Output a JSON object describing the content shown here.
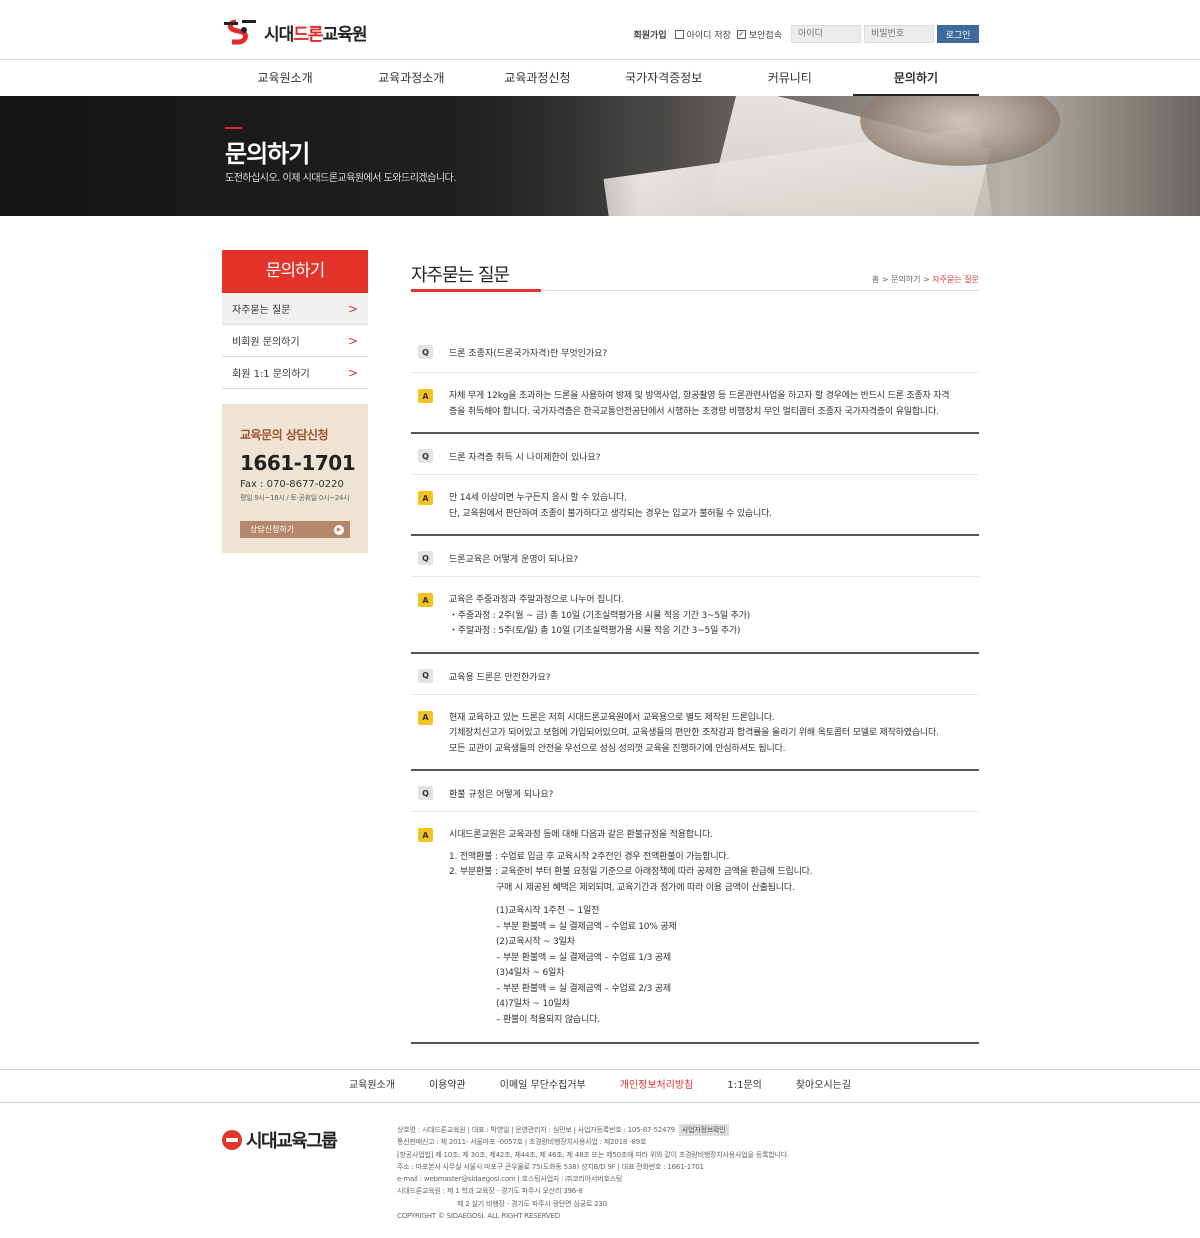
{
  "header": {
    "logo_text_pre": "시대",
    "logo_text_red": "드론",
    "logo_text_post": "교육원",
    "join": "회원가입",
    "save_id": "아이디 저장",
    "secure": "보안접속",
    "id_placeholder": "아이디",
    "pw_placeholder": "비밀번호",
    "login": "로그인"
  },
  "gnb": [
    "교육원소개",
    "교육과정소개",
    "교육과정신청",
    "국가자격증정보",
    "커뮤니티",
    "문의하기"
  ],
  "banner": {
    "title": "문의하기",
    "subtitle": "도전하십시오. 이제 시대드론교육원에서 도와드리겠습니다."
  },
  "lnb": {
    "title": "문의하기",
    "items": [
      "자주묻는 질문",
      "비회원 문의하기",
      "회원 1:1 문의하기"
    ]
  },
  "counsel": {
    "title": "교육문의 상담신청",
    "tel": "1661-1701",
    "fax": "Fax : 070-8677-0220",
    "hours": "평일 9시~18시 / 토·공휴일 0시~24시",
    "button": "상담신청하기"
  },
  "content": {
    "title": "자주묻는 질문",
    "breadcrumb": {
      "home": "홈",
      "sep": ">",
      "level1": "문의하기",
      "current": "자주묻는 질문"
    }
  },
  "faq": [
    {
      "q": "드론 조종자(드론국가자격)란 무엇인가요?",
      "a": [
        "자체 무게 12kg을 초과하는 드론을 사용하여 방제 및 방역사업, 항공촬영 등 드론관련사업을 하고자 할 경우에는 반드시 드론 조종자 자격",
        "증을 취득해야 합니다. 국가자격증은 한국교통안전공단에서 시행하는 초경량 비행장치 무인 멀티콥터 조종자 국가자격증이 유일합니다."
      ]
    },
    {
      "q": "드론 자격증 취득 시 나이제한이 있나요?",
      "a": [
        "만 14세 이상이면 누구든지 응시 할 수 있습니다.",
        "단, 교육원에서 판단하여 조종이 불가하다고 생각되는 경우는 입교가 불허될 수 있습니다."
      ]
    },
    {
      "q": "드론교육은 어떻게 운영이 되나요?",
      "a": [
        "교육은 주중과정과 주말과정으로 나누어 집니다.",
        "・주중과정 : 2주(월 ~ 금) 총 10일 (기초실력평가용 시뮬 적응 기간 3~5일 추가)",
        "・주말과정 : 5주(토/일) 총 10일 (기초실력평가용 시뮬 적응 기간 3~5일 추가)"
      ]
    },
    {
      "q": "교육용 드론은 안전한가요?",
      "a": [
        "현재 교육하고 있는 드론은 저희 시대드론교육원에서 교육용으로 별도 제작된 드론입니다.",
        "기체장치신고가 되어있고 보험에 가입되어있으며, 교육생들의 편안한 조작감과 합격률을 올리기 위해 옥토콥터 모델로 제작하였습니다.",
        "모든 교관이 교육생들의 안전을 우선으로 성심 성의껏 교육을 진행하기에 안심하셔도 됩니다."
      ]
    },
    {
      "q": "환불 규정은 어떻게 되나요?",
      "a_intro": "시대드론교원은 교육과정 등에 대해 다음과 같은 환불규정을 적용합니다.",
      "a_list": [
        "1. 전액환불 : 수업료 입금 후 교육시작 2주전인 경우 전액환불이 가능합니다.",
        "2. 부분환불 : 교육준비 부터 환불 요청일 기준으로 아래정책에 따라 공제한 금액을 환급해 드립니다."
      ],
      "a_list_note": "구매 시 제공된 혜택은 제외되며, 교육기간과 정가에 따라 이용 금액이 산출됩니다.",
      "a_detail": [
        "(1)교육시작 1주전 ~ 1일전",
        "– 부분 환불액 = 실 결제금액 – 수업료 10% 공제",
        "(2)교육시작 ~ 3일차",
        "– 부분 환불액 = 실 결제금액 – 수업료 1/3 공제",
        "(3)4일차 ~ 6일차",
        "– 부분 환불액 = 실 결제금액 – 수업료 2/3 공제",
        "(4)7일차 ~ 10일차",
        "– 환불이 적용되지 않습니다."
      ]
    }
  ],
  "footer": {
    "nav": [
      "교육원소개",
      "이용약관",
      "이메일 무단수집거부",
      "개인정보처리방침",
      "1:1문의",
      "찾아오시는길"
    ],
    "logo": "시대교육그룹",
    "info": [
      "상호명 : 시대드론교육원 | 대표 : 박영일 | 운영관리자 : 심민보 | 사업자등록번호 : 105-87-52479",
      "통신판매신고 : 제 2011- 서울마포 -0057호 | 초경량비행장치사용사업 : 제2018 -89호",
      "[항공사업법] 제 10조, 제 30조, 제42조, 제44조, 제 46조, 제 48조 또는 제50조에 따라 위와 같이 초경량비행장치사용사업을 등록합니다.",
      "주소 : 마포본사 사무실 서울시 마포구 큰우물로 75(도화동 538) 성지B/D 9F | 대표 전화번호 : 1661-1701",
      "e-mail : webmaster@sidaegosi.com | 호스팅사업자 : ㈜코리아서버호스팅",
      "시대드론교육원 : 제 1 학과 교육장 - 경기도 파주시 오산리 396-8",
      "제 2 실기 비행장 - 경기도 파주시 광탄면 심궁로 230",
      "COPYRIGHT © SIDAEGOSI. ALL RIGHT RESERVED"
    ],
    "info_button": "사업자정보확인"
  },
  "colors": {
    "accent": "#e4332b",
    "badge_a": "#f6c21f",
    "login_btn": "#3f6a9e",
    "counsel_bg": "#efe3d3"
  }
}
